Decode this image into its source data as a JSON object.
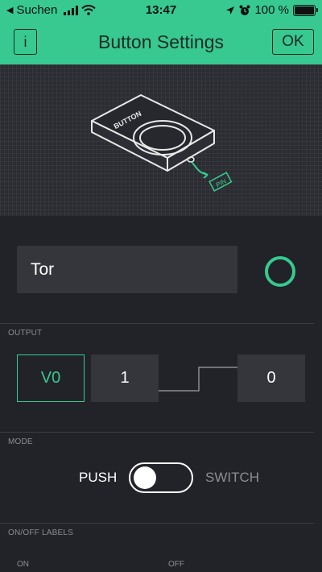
{
  "status_bar": {
    "carrier": "Suchen",
    "back_glyph": "◀",
    "time": "13:47",
    "battery": "100 %",
    "icons": [
      "signal-icon",
      "wifi-icon",
      "location-icon",
      "alarm-icon",
      "battery-icon"
    ]
  },
  "header": {
    "title": "Button Settings",
    "info_label": "i",
    "ok_label": "OK"
  },
  "preview": {
    "device_label": "BUTTON",
    "pin_label": "PIN"
  },
  "name_field": {
    "value": "Tor"
  },
  "colors": {
    "accent": "#37c98f",
    "background": "#212328",
    "field": "#34363b",
    "muted": "#8b8d92"
  },
  "output": {
    "section_label": "OUTPUT",
    "pin": "V0",
    "on_value": "1",
    "off_value": "0"
  },
  "mode": {
    "section_label": "MODE",
    "push_label": "PUSH",
    "switch_label": "SWITCH",
    "selected": "PUSH"
  },
  "labels": {
    "section_label": "ON/OFF LABELS",
    "on_label": "ON",
    "off_label": "OFF"
  }
}
